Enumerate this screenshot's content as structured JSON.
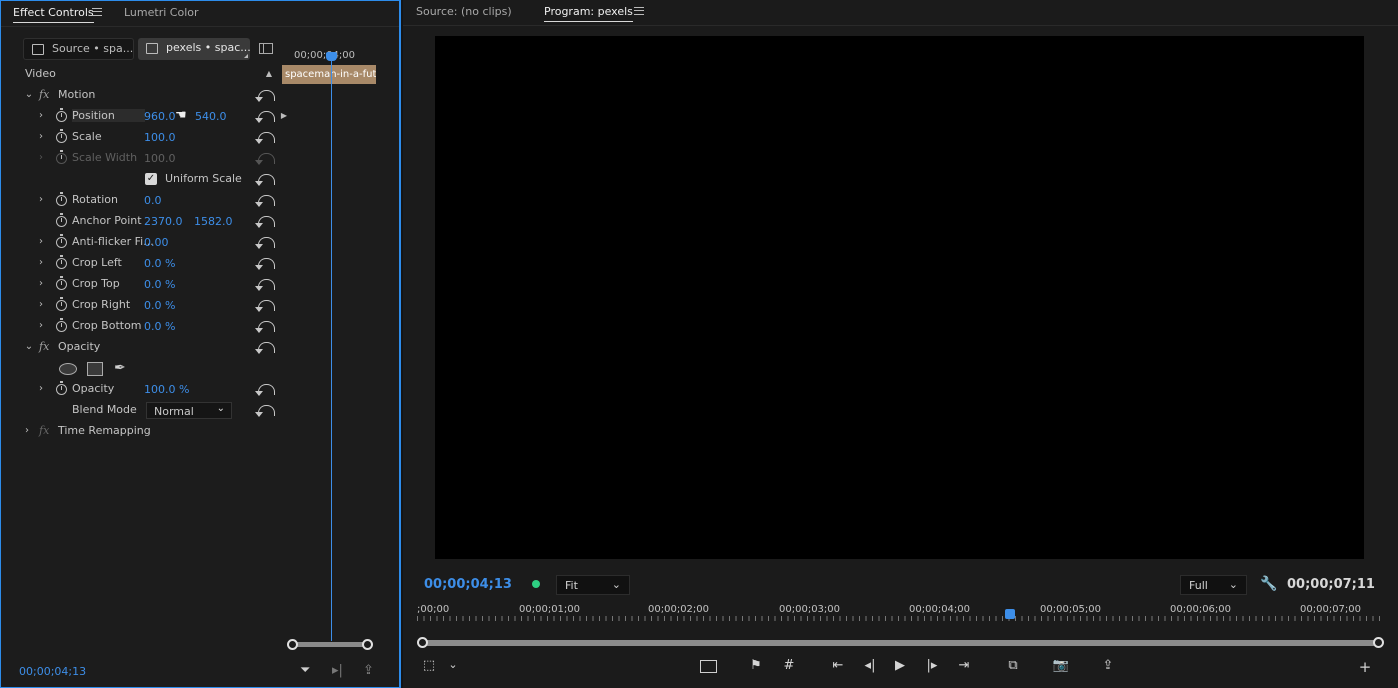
{
  "effect_controls": {
    "tabs": [
      {
        "label": "Effect Controls",
        "active": true
      },
      {
        "label": "Lumetri Color",
        "active": false
      }
    ],
    "source_button": "Source • spa...",
    "sequence_button": "pexels • spac...",
    "section_video": "Video",
    "rows": {
      "motion": {
        "label": "Motion"
      },
      "position": {
        "label": "Position",
        "value1": "960.0",
        "value2": "540.0"
      },
      "scale": {
        "label": "Scale",
        "value1": "100.0"
      },
      "scale_width": {
        "label": "Scale Width",
        "value1": "100.0"
      },
      "uniform_scale": {
        "label": "Uniform Scale",
        "checked": true
      },
      "rotation": {
        "label": "Rotation",
        "value1": "0.0"
      },
      "anchor_point": {
        "label": "Anchor Point",
        "value1": "2370.0",
        "value2": "1582.0"
      },
      "anti_flicker": {
        "label": "Anti-flicker Fi...",
        "value1": "0.00"
      },
      "crop_left": {
        "label": "Crop Left",
        "value1": "0.0 %"
      },
      "crop_top": {
        "label": "Crop Top",
        "value1": "0.0 %"
      },
      "crop_right": {
        "label": "Crop Right",
        "value1": "0.0 %"
      },
      "crop_bottom": {
        "label": "Crop Bottom",
        "value1": "0.0 %"
      },
      "opacity_group": {
        "label": "Opacity"
      },
      "opacity": {
        "label": "Opacity",
        "value1": "100.0 %"
      },
      "blend_mode": {
        "label": "Blend Mode",
        "value1": "Normal"
      },
      "time_remapping": {
        "label": "Time Remapping"
      }
    },
    "mini_timeline": {
      "timecode": "00;00;04;00",
      "clip_name": "spaceman-in-a-futu"
    },
    "current_timecode": "00;00;04;13"
  },
  "program_monitor": {
    "tabs": [
      {
        "label": "Source: (no clips)",
        "active": false
      },
      {
        "label": "Program: pexels",
        "active": true
      }
    ],
    "current_timecode": "00;00;04;13",
    "zoom": "Fit",
    "resolution": "Full",
    "duration": "00;00;07;11",
    "ruler_labels": [
      ";00;00",
      "00;00;01;00",
      "00;00;02;00",
      "00;00;03;00",
      "00;00;04;00",
      "00;00;05;00",
      "00;00;06;00",
      "00;00;07;00"
    ]
  },
  "colors": {
    "accent_blue": "#3d8ee8",
    "clip_tan": "#a88968",
    "indicator_green": "#2ecf82"
  }
}
